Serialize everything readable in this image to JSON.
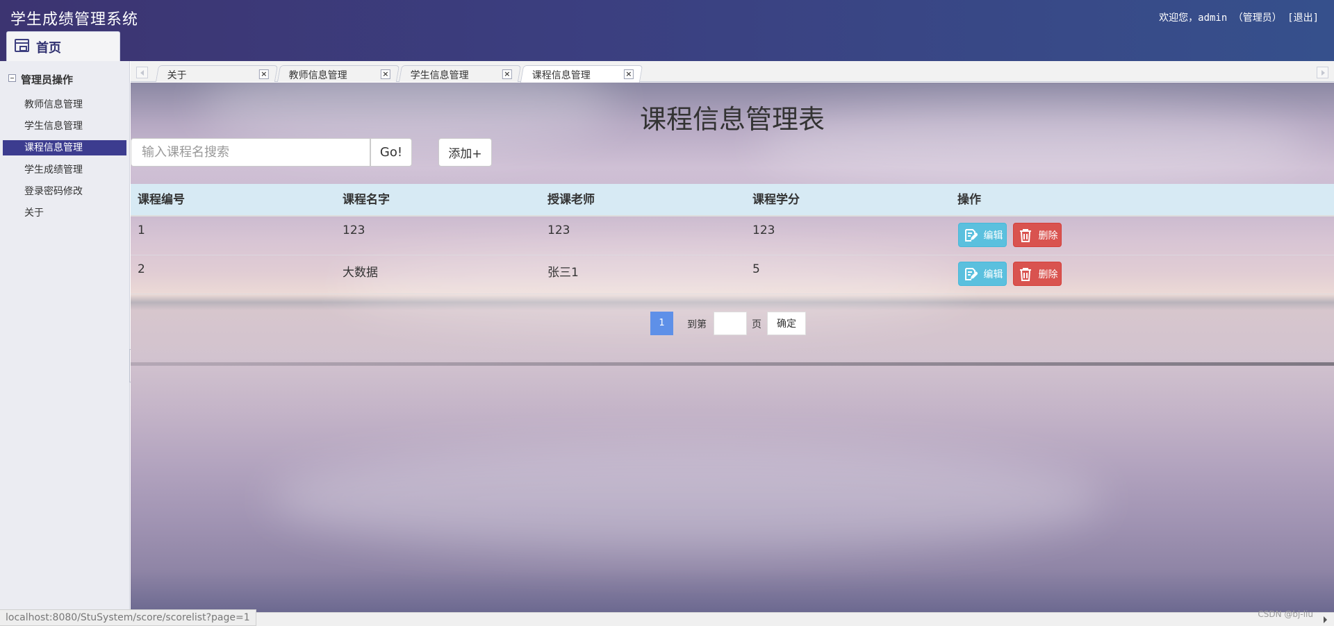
{
  "header": {
    "app_title": "学生成绩管理系统",
    "welcome_text": "欢迎您，admin （管理员）  [退出]",
    "home_tab_label": "首页"
  },
  "sidebar": {
    "group_title": "管理员操作",
    "items": [
      {
        "label": "教师信息管理",
        "active": false
      },
      {
        "label": "学生信息管理",
        "active": false
      },
      {
        "label": "课程信息管理",
        "active": true
      },
      {
        "label": "学生成绩管理",
        "active": false
      },
      {
        "label": "登录密码修改",
        "active": false
      },
      {
        "label": "关于",
        "active": false
      }
    ]
  },
  "tabs": [
    {
      "label": "关于",
      "active": false
    },
    {
      "label": "教师信息管理",
      "active": false
    },
    {
      "label": "学生信息管理",
      "active": false
    },
    {
      "label": "课程信息管理",
      "active": true
    }
  ],
  "main": {
    "title": "课程信息管理表",
    "search": {
      "placeholder": "输入课程名搜索",
      "value": "",
      "button_label": "Go!"
    },
    "add_button_label": "添加+",
    "table": {
      "columns": [
        "课程编号",
        "课程名字",
        "授课老师",
        "课程学分",
        "操作"
      ],
      "rows": [
        [
          "1",
          "123",
          "123",
          "123"
        ],
        [
          "2",
          "大数据",
          "张三1",
          "5"
        ]
      ],
      "edit_label": "编辑",
      "delete_label": "删除"
    },
    "pagination": {
      "current_page": "1",
      "goto_label": "到第",
      "page_label": "页",
      "confirm_label": "确定"
    }
  },
  "status_url": "localhost:8080/StuSystem/score/scorelist?page=1",
  "watermark": "CSDN @bj-liu",
  "colors": {
    "header": "#3b3f80",
    "sidebar_active": "#3c3c8f",
    "table_header": "#d7ebf5",
    "edit_button": "#5bc0de",
    "delete_button": "#d9534f",
    "current_page": "#5e90e8"
  }
}
